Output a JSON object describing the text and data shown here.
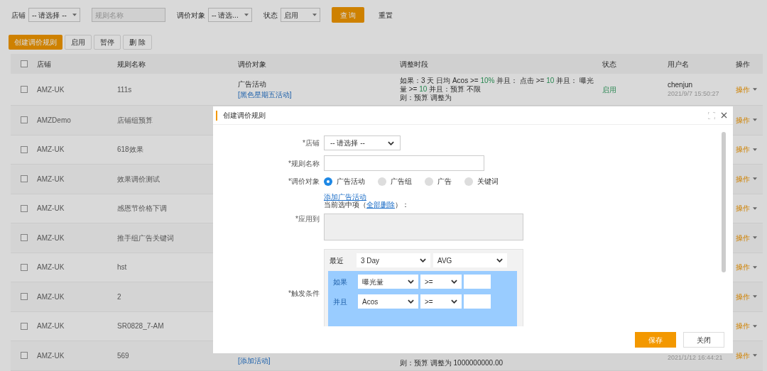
{
  "filters": [
    {
      "kind": "select",
      "label": "店铺",
      "value": "-- 请选择 --"
    },
    {
      "kind": "input",
      "placeholder": "规则名称"
    },
    {
      "kind": "select",
      "label": "调价对象",
      "value": "-- 请选..."
    },
    {
      "kind": "select",
      "label": "状态",
      "value": "启用"
    }
  ],
  "filter_buttons": [
    {
      "label": "查 询",
      "primary": true
    },
    {
      "label": "重置",
      "primary": false
    }
  ],
  "toolbar": [
    {
      "label": "创建调价规则",
      "primary": true
    },
    {
      "label": "启用",
      "primary": false
    },
    {
      "label": "暂停",
      "primary": false
    },
    {
      "label": "删 除",
      "primary": false
    }
  ],
  "table": {
    "columns": [
      "店铺",
      "规则名称",
      "调价对象",
      "调整时段",
      "状态",
      "用户名",
      "操作"
    ],
    "header_checked": false,
    "rows": [
      {
        "checked": false,
        "store": "AMZ-UK",
        "name": "111s",
        "object": "广告活动",
        "object_link": "[黑色星期五活动]",
        "condition": [
          {
            "text": "如果：3 天 日均 Acos >= ",
            "highlight": false
          },
          {
            "text": "10%",
            "highlight": true
          },
          {
            "text": " 并且： 点击 >= ",
            "highlight": false
          },
          {
            "text": "10",
            "highlight": true
          },
          {
            "text": " 并且： 曝光量 >= ",
            "highlight": false
          },
          {
            "text": "10",
            "highlight": true
          },
          {
            "text": " 并且：预算 不限",
            "highlight": false
          }
        ],
        "then": "则：预算 调整为",
        "status": "启用",
        "user": "chenjun",
        "time": "2021/9/7 15:50:27",
        "action": "操作"
      },
      {
        "checked": false,
        "store": "AMZDemo",
        "name": "店铺组预算",
        "action": "操作"
      },
      {
        "checked": false,
        "store": "AMZ-UK",
        "name": "618效果",
        "action": "操作"
      },
      {
        "checked": false,
        "store": "AMZ-UK",
        "name": "效果调价测试",
        "action": "操作"
      },
      {
        "checked": false,
        "store": "AMZ-UK",
        "name": "感恩节价格下调",
        "action": "操作"
      },
      {
        "checked": false,
        "store": "AMZ-UK",
        "name": "推手组广告关键词",
        "action": "操作"
      },
      {
        "checked": false,
        "store": "AMZ-UK",
        "name": "hst",
        "action": "操作"
      },
      {
        "checked": false,
        "store": "AMZ-UK",
        "name": "2",
        "action": "操作"
      },
      {
        "checked": false,
        "store": "AMZ-UK",
        "name": "SR0828_7-AM",
        "action": "操作"
      },
      {
        "checked": false,
        "store": "AMZ-UK",
        "name": "569",
        "object_link": "[添加活动]",
        "then": "则：预算 调整为 1000000000.00",
        "time": "2021/1/12 16:44:21",
        "action": "操作"
      }
    ]
  },
  "dialog": {
    "title": "创建调价规则",
    "fields": [
      {
        "kind": "select",
        "label": "*店铺",
        "value": "-- 请选择 --"
      },
      {
        "kind": "input",
        "label": "*规则名称"
      },
      {
        "kind": "radio",
        "label": "*调价对象",
        "options": [
          {
            "label": "广告活动",
            "selected": true
          },
          {
            "label": "广告组",
            "selected": false
          },
          {
            "label": "广告",
            "selected": false
          },
          {
            "label": "关键词",
            "selected": false
          }
        ],
        "link": "添加广告活动",
        "selection_before": "当前选中项（",
        "selection_link": "全部删除",
        "selection_after": "）："
      },
      {
        "kind": "textarea",
        "label": "*应用到"
      },
      {
        "kind": "trigger",
        "label": "*触发条件",
        "period_label": "最近",
        "period": "3 Day",
        "aggregate": "AVG",
        "conditions": [
          {
            "joiner": "如果",
            "metric": "曝光量",
            "operator": ">="
          },
          {
            "joiner": "并且",
            "metric": "Acos",
            "operator": ">="
          }
        ]
      }
    ],
    "buttons": [
      {
        "label": "保存",
        "primary": true
      },
      {
        "label": "关闭",
        "primary": false
      }
    ]
  }
}
